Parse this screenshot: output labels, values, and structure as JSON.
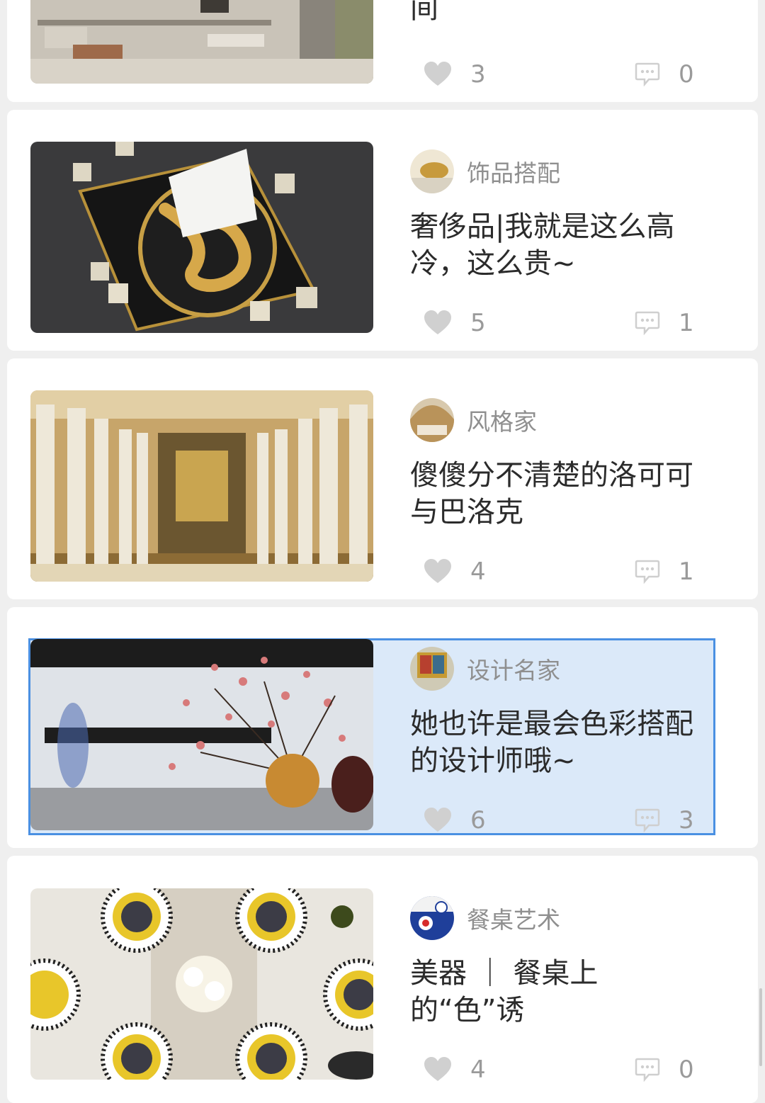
{
  "feed": {
    "cards": [
      {
        "category": "",
        "title": "间",
        "likes": "3",
        "comments": "0",
        "image": "wardrobe-room-photo"
      },
      {
        "category": "饰品搭配",
        "title": "奢侈品|我就是这么高冷，这么贵~",
        "likes": "5",
        "comments": "1",
        "image": "gold-crocodile-tray-dice-photo"
      },
      {
        "category": "风格家",
        "title": "傻傻分不清楚的洛可可与巴洛克",
        "likes": "4",
        "comments": "1",
        "image": "baroque-chapel-organ-photo"
      },
      {
        "category": "设计名家",
        "title": "她也许是最会色彩搭配的设计师哦~",
        "likes": "6",
        "comments": "3",
        "image": "blossom-branch-vases-photo",
        "selected": true
      },
      {
        "category": "餐桌艺术",
        "title": "美器 ｜ 餐桌上的“色”诱",
        "likes": "4",
        "comments": "0",
        "image": "table-setting-plates-photo"
      }
    ]
  },
  "icons": {
    "like": "heart-icon",
    "comment": "comment-bubble-icon"
  },
  "colors": {
    "background": "#efefef",
    "card": "#ffffff",
    "selection_border": "#4a90e2",
    "selection_fill": "#dbe9f9",
    "icon_gray": "#d0d0d0",
    "meta_text": "#8f8f8f",
    "title_text": "#2b2b2b"
  }
}
